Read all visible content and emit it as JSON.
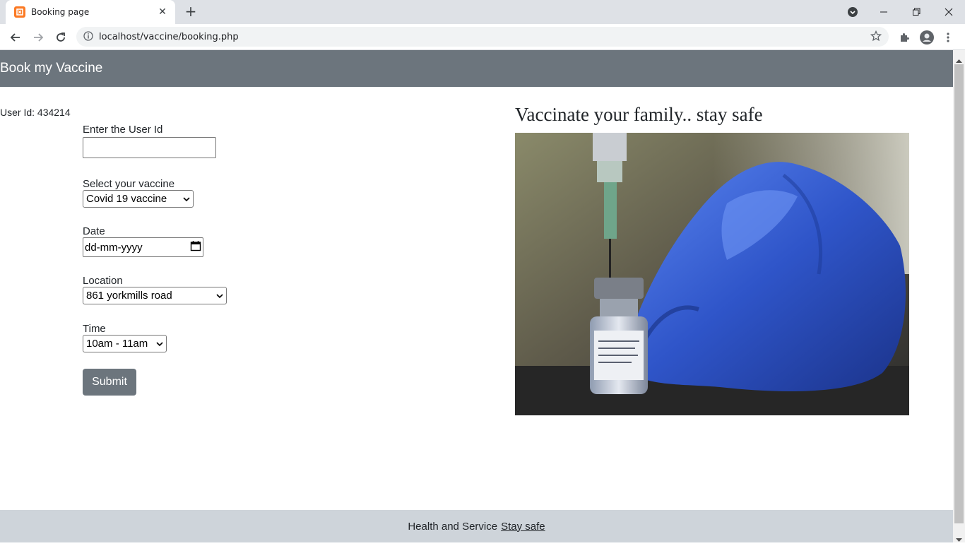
{
  "browser": {
    "tab_title": "Booking page",
    "url": "localhost/vaccine/booking.php"
  },
  "header": {
    "brand": "Book my Vaccine"
  },
  "user": {
    "line": "User Id: 434214"
  },
  "form": {
    "user_id_label": "Enter the User Id",
    "user_id_value": "",
    "vaccine_label": "Select your vaccine",
    "vaccine_selected": "Covid 19 vaccine",
    "date_label": "Date",
    "date_placeholder": "dd-mm-yyyy",
    "location_label": "Location",
    "location_selected": "861 yorkmills road",
    "time_label": "Time",
    "time_selected": "10am - 11am",
    "submit_label": "Submit"
  },
  "side": {
    "heading": "Vaccinate your family.. stay safe"
  },
  "footer": {
    "text": "Health and Service",
    "link": "Stay safe"
  },
  "colors": {
    "header_bg": "#6c757d",
    "footer_bg": "#ced4da",
    "glove": "#3a62d6"
  }
}
